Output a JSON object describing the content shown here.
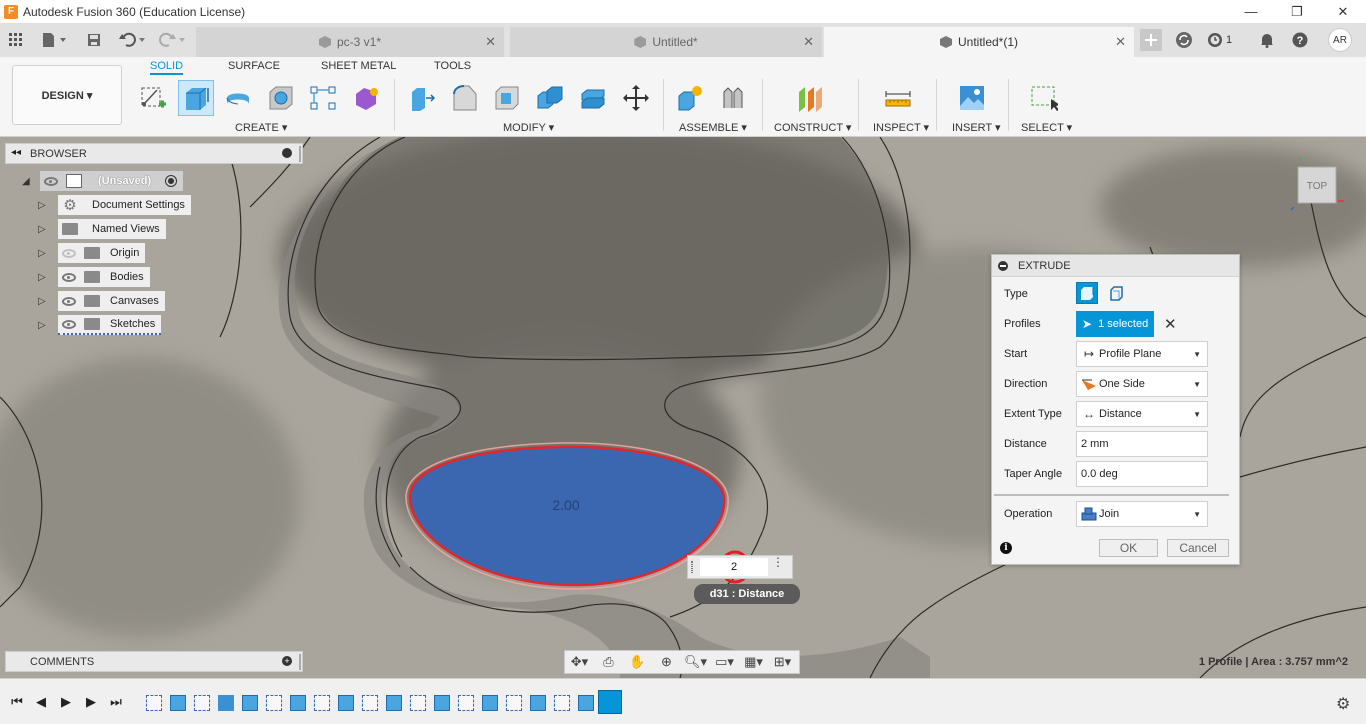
{
  "window": {
    "title": "Autodesk Fusion 360 (Education License)",
    "logo_letter": "F",
    "minimize_icon": "—",
    "restore_icon": "❐",
    "close_icon": "✕"
  },
  "tabs": [
    {
      "label": "pc-3 v1*",
      "active": false
    },
    {
      "label": "Untitled*",
      "active": false
    },
    {
      "label": "Untitled*(1)",
      "active": true
    }
  ],
  "tabbar_right": {
    "job_count": "1",
    "avatar_initials": "AR"
  },
  "ribbon": {
    "workspace_button": "DESIGN ▾",
    "tabs": [
      "SOLID",
      "SURFACE",
      "SHEET METAL",
      "TOOLS"
    ],
    "groups": [
      "CREATE ▾",
      "MODIFY ▾",
      "ASSEMBLE ▾",
      "CONSTRUCT ▾",
      "INSPECT ▾",
      "INSERT ▾",
      "SELECT ▾"
    ]
  },
  "browser": {
    "title": "BROWSER",
    "root": "(Unsaved)",
    "items": [
      "Document Settings",
      "Named Views",
      "Origin",
      "Bodies",
      "Canvases",
      "Sketches"
    ]
  },
  "comments": {
    "title": "COMMENTS"
  },
  "extrude": {
    "title": "EXTRUDE",
    "type_label": "Type",
    "profiles_label": "Profiles",
    "profiles_value": "1 selected",
    "start_label": "Start",
    "start_value": "Profile Plane",
    "direction_label": "Direction",
    "direction_value": "One Side",
    "extent_label": "Extent Type",
    "extent_value": "Distance",
    "distance_label": "Distance",
    "distance_value": "2 mm",
    "taper_label": "Taper Angle",
    "taper_value": "0.0 deg",
    "operation_label": "Operation",
    "operation_value": "Join",
    "ok": "OK",
    "cancel": "Cancel",
    "info_glyph": "i"
  },
  "canvas": {
    "dimension_text": "2.00",
    "dim_input_value": "2",
    "dim_tooltip": "d31 : Distance",
    "viewcube_label": "TOP",
    "status": "1 Profile | Area : 3.757 mm^2"
  },
  "colors": {
    "accent": "#0696d7",
    "profile_fill": "#3b66b0",
    "profile_outline": "#e0282c",
    "highlight_circle": "#e31e24"
  }
}
